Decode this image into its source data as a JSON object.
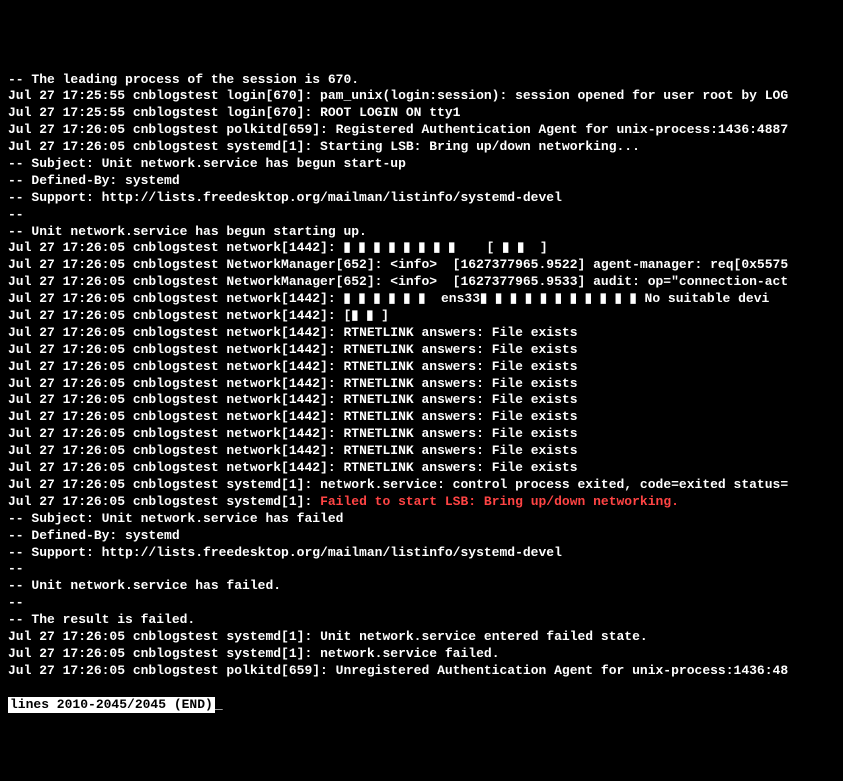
{
  "lines": [
    {
      "prefix": "-- The leading process of the session is 670.",
      "bold": "",
      "normal": ""
    },
    {
      "prefix": "Jul 27 17:25:55 cnblogstest login[670]: pam_unix(login:session): session opened for user root by LOG",
      "bold": "",
      "normal": ""
    },
    {
      "prefix": "Jul 27 17:25:55 cnblogstest login[670]: ",
      "bold": "ROOT LOGIN ON tty1",
      "normal": ""
    },
    {
      "prefix": "Jul 27 17:26:05 cnblogstest polkitd[659]: ",
      "bold": "Registered Authentication Agent for unix-process:1436:4887",
      "normal": ""
    },
    {
      "prefix": "Jul 27 17:26:05 cnblogstest systemd[1]: Starting LSB: Bring up/down networking...",
      "bold": "",
      "normal": ""
    },
    {
      "prefix": "-- Subject: Unit network.service has begun start-up",
      "bold": "",
      "normal": ""
    },
    {
      "prefix": "-- Defined-By: systemd",
      "bold": "",
      "normal": ""
    },
    {
      "prefix": "-- Support: http://lists.freedesktop.org/mailman/listinfo/systemd-devel",
      "bold": "",
      "normal": ""
    },
    {
      "prefix": "--",
      "bold": "",
      "normal": ""
    },
    {
      "prefix": "-- Unit network.service has begun starting up.",
      "bold": "",
      "normal": ""
    },
    {
      "prefix": "Jul 27 17:26:05 cnblogstest network[1442]: ",
      "bold": "▮ ▮ ▮ ▮ ▮ ▮ ▮ ▮    [ ▮ ▮  ]",
      "normal": ""
    },
    {
      "prefix": "Jul 27 17:26:05 cnblogstest NetworkManager[652]: <info>  [1627377965.9522] agent-manager: req[0x5575",
      "bold": "",
      "normal": ""
    },
    {
      "prefix": "Jul 27 17:26:05 cnblogstest NetworkManager[652]: <info>  [1627377965.9533] audit: op=\"connection-act",
      "bold": "",
      "normal": ""
    },
    {
      "prefix": "Jul 27 17:26:05 cnblogstest network[1442]: ",
      "bold": "▮ ▮ ▮ ▮ ▮ ▮  ens33▮ ▮ ▮ ▮ ▮ ▮ ▮ ▮ ▮ ▮ ▮ No suitable devi",
      "normal": ""
    },
    {
      "prefix": "Jul 27 17:26:05 cnblogstest network[1442]: ",
      "bold": "[▮ ▮ ]",
      "normal": ""
    },
    {
      "prefix": "Jul 27 17:26:05 cnblogstest network[1442]: ",
      "bold": "RTNETLINK answers: File exists",
      "normal": ""
    },
    {
      "prefix": "Jul 27 17:26:05 cnblogstest network[1442]: ",
      "bold": "RTNETLINK answers: File exists",
      "normal": ""
    },
    {
      "prefix": "Jul 27 17:26:05 cnblogstest network[1442]: ",
      "bold": "RTNETLINK answers: File exists",
      "normal": ""
    },
    {
      "prefix": "Jul 27 17:26:05 cnblogstest network[1442]: ",
      "bold": "RTNETLINK answers: File exists",
      "normal": ""
    },
    {
      "prefix": "Jul 27 17:26:05 cnblogstest network[1442]: ",
      "bold": "RTNETLINK answers: File exists",
      "normal": ""
    },
    {
      "prefix": "Jul 27 17:26:05 cnblogstest network[1442]: ",
      "bold": "RTNETLINK answers: File exists",
      "normal": ""
    },
    {
      "prefix": "Jul 27 17:26:05 cnblogstest network[1442]: ",
      "bold": "RTNETLINK answers: File exists",
      "normal": ""
    },
    {
      "prefix": "Jul 27 17:26:05 cnblogstest network[1442]: ",
      "bold": "RTNETLINK answers: File exists",
      "normal": ""
    },
    {
      "prefix": "Jul 27 17:26:05 cnblogstest network[1442]: ",
      "bold": "RTNETLINK answers: File exists",
      "normal": ""
    },
    {
      "prefix": "Jul 27 17:26:05 cnblogstest systemd[1]: ",
      "bold": "network.service: control process exited, code=exited status=",
      "normal": ""
    },
    {
      "prefix": "Jul 27 17:26:05 cnblogstest systemd[1]: ",
      "red": "Failed to start LSB: Bring up/down networking.",
      "normal": ""
    },
    {
      "prefix": "-- Subject: Unit network.service has failed",
      "bold": "",
      "normal": ""
    },
    {
      "prefix": "-- Defined-By: systemd",
      "bold": "",
      "normal": ""
    },
    {
      "prefix": "-- Support: http://lists.freedesktop.org/mailman/listinfo/systemd-devel",
      "bold": "",
      "normal": ""
    },
    {
      "prefix": "--",
      "bold": "",
      "normal": ""
    },
    {
      "prefix": "-- Unit network.service has failed.",
      "bold": "",
      "normal": ""
    },
    {
      "prefix": "--",
      "bold": "",
      "normal": ""
    },
    {
      "prefix": "-- The result is failed.",
      "bold": "",
      "normal": ""
    },
    {
      "prefix": "Jul 27 17:26:05 cnblogstest systemd[1]: ",
      "bold": "Unit network.service entered failed state.",
      "normal": ""
    },
    {
      "prefix": "Jul 27 17:26:05 cnblogstest systemd[1]: ",
      "bold": "network.service failed.",
      "normal": ""
    },
    {
      "prefix": "Jul 27 17:26:05 cnblogstest polkitd[659]: ",
      "bold": "Unregistered Authentication Agent for unix-process:1436:48",
      "normal": ""
    }
  ],
  "status": "lines 2010-2045/2045 (END)",
  "cursor": "_"
}
